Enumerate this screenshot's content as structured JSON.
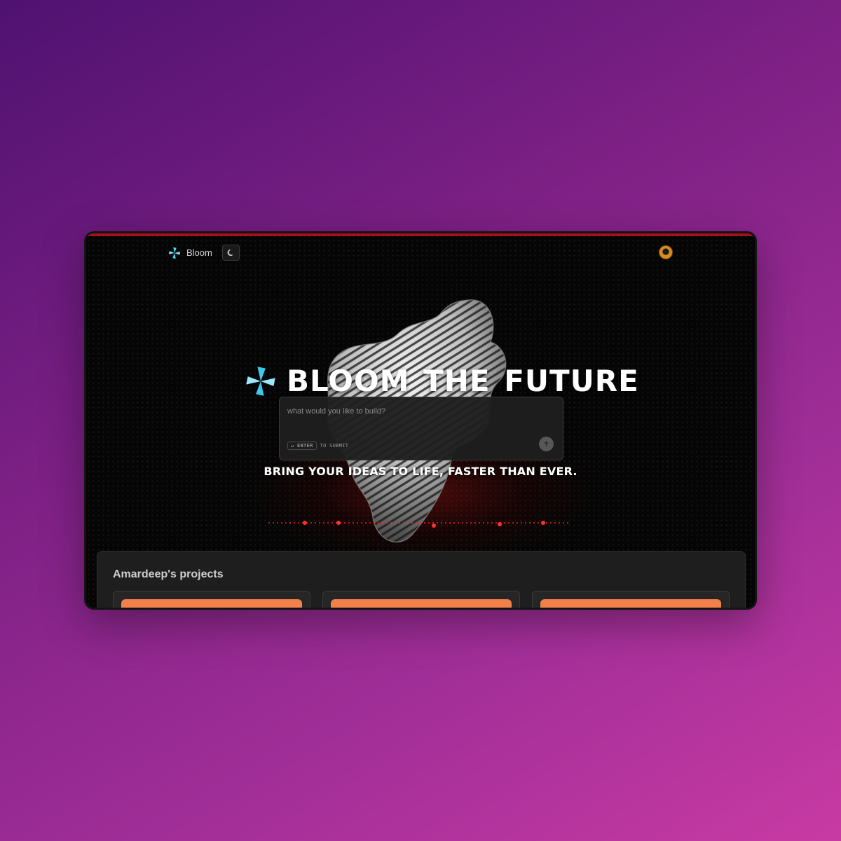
{
  "app": {
    "name": "Bloom"
  },
  "nav": {
    "theme_toggle_icon": "moon-icon",
    "avatar_icon": "user-avatar"
  },
  "hero": {
    "title": "BLOOM THE FUTURE",
    "prompt_placeholder": "what would you like to build?",
    "hint_key": "↵ ENTER",
    "hint_text": "TO SUBMIT",
    "submit_icon": "arrow-up-icon",
    "tagline": "BRING YOUR IDEAS TO LIFE, FASTER THAN EVER."
  },
  "projects": {
    "title": "Amardeep's projects",
    "cards": [
      {
        "thumb_color": "#f2804a"
      },
      {
        "thumb_color": "#f2804a"
      },
      {
        "thumb_color": "#f2804a"
      }
    ]
  },
  "colors": {
    "background_gradient_start": "#4f1270",
    "background_gradient_end": "#c83aa3",
    "accent_red": "#a3101a",
    "logo_cyan": "#4fd4f0",
    "card_accent": "#f2804a"
  }
}
